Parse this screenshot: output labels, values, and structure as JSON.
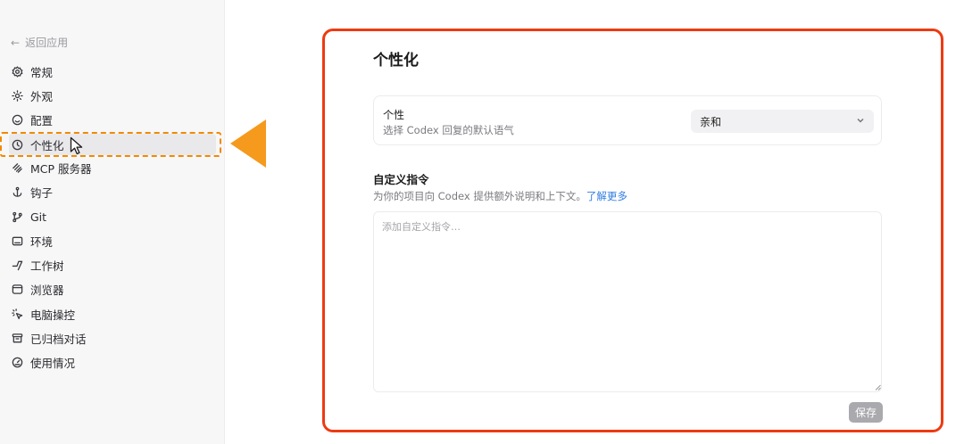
{
  "sidebar": {
    "back_label": "返回应用",
    "items": [
      {
        "label": "常规",
        "icon": "gear-icon"
      },
      {
        "label": "外观",
        "icon": "sun-icon"
      },
      {
        "label": "配置",
        "icon": "smile-icon"
      },
      {
        "label": "个性化",
        "icon": "personalize-icon"
      },
      {
        "label": "MCP 服务器",
        "icon": "mcp-icon"
      },
      {
        "label": "钩子",
        "icon": "anchor-icon"
      },
      {
        "label": "Git",
        "icon": "git-icon"
      },
      {
        "label": "环境",
        "icon": "terminal-icon"
      },
      {
        "label": "工作树",
        "icon": "worktree-icon"
      },
      {
        "label": "浏览器",
        "icon": "browser-icon"
      },
      {
        "label": "电脑操控",
        "icon": "cursor-sparkle-icon"
      },
      {
        "label": "已归档对话",
        "icon": "archive-icon"
      },
      {
        "label": "使用情况",
        "icon": "gauge-icon"
      }
    ],
    "active_index": 3
  },
  "main": {
    "title": "个性化",
    "personality": {
      "title": "个性",
      "subtitle": "选择 Codex 回复的默认语气",
      "selected": "亲和"
    },
    "custom_instructions": {
      "title": "自定义指令",
      "description": "为你的项目向 Codex 提供额外说明和上下文。",
      "learn_more": "了解更多",
      "placeholder": "添加自定义指令…",
      "value": ""
    },
    "save_label": "保存"
  },
  "colors": {
    "annotation_orange": "#f59a1d",
    "annotation_red": "#ee3a12",
    "link": "#2f7de1"
  }
}
